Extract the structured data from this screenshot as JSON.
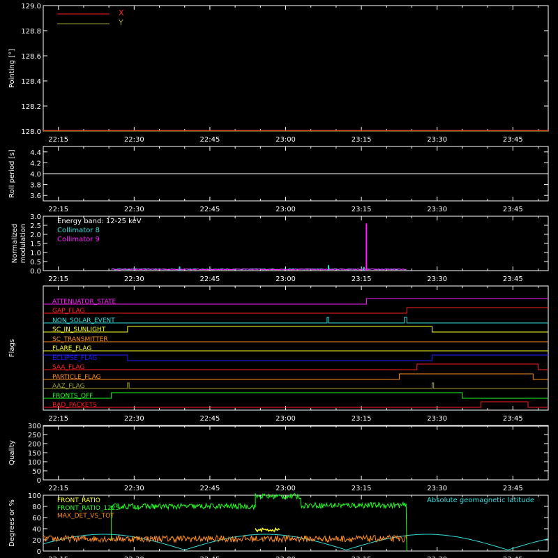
{
  "time_ticks": [
    "22:15",
    "22:30",
    "22:45",
    "23:00",
    "23:15",
    "23:30",
    "23:45"
  ],
  "time_tick_values": [
    0,
    15,
    30,
    45,
    60,
    75,
    90
  ],
  "time_range": [
    -3,
    97
  ],
  "colors": {
    "white": "#ffffff",
    "red": "#ff2020",
    "olive": "#a0a030",
    "cyan": "#30e0e0",
    "magenta": "#ff20ff",
    "green": "#20ff20",
    "orange": "#ff8c20",
    "yellow": "#ffff20",
    "blue": "#2020ff",
    "salmon": "#ff5050"
  },
  "chart_data": [
    {
      "type": "line",
      "ylabel": "Pointing [°]",
      "ylim": [
        128.0,
        129.0
      ],
      "yticks": [
        "128.0",
        "128.2",
        "128.4",
        "128.6",
        "128.8",
        "129.0"
      ],
      "ytick_values": [
        128.0,
        128.2,
        128.4,
        128.6,
        128.8,
        129.0
      ],
      "legend": [
        "X",
        "Y"
      ],
      "series": [
        {
          "name": "X",
          "x": [
            -3,
            97
          ],
          "y": [
            128.0,
            128.0
          ]
        },
        {
          "name": "Y",
          "x": [
            -3,
            97
          ],
          "y": [
            128.0,
            128.0
          ]
        }
      ]
    },
    {
      "type": "line",
      "ylabel": "Roll period [s]",
      "ylim": [
        3.5,
        4.5
      ],
      "yticks": [
        "3.6",
        "3.8",
        "4.0",
        "4.2",
        "4.4"
      ],
      "ytick_values": [
        3.6,
        3.8,
        4.0,
        4.2,
        4.4
      ],
      "series": [
        {
          "x": [
            -3,
            97
          ],
          "y": [
            4.0,
            4.0
          ]
        }
      ]
    },
    {
      "type": "line",
      "ylabel": "Normalized modulation",
      "ylim": [
        0.0,
        3.0
      ],
      "yticks": [
        "0.0",
        "0.5",
        "1.0",
        "1.5",
        "2.0",
        "2.5",
        "3.0"
      ],
      "ytick_values": [
        0.0,
        0.5,
        1.0,
        1.5,
        2.0,
        2.5,
        3.0
      ],
      "legend": [
        "Energy band: 12-25 keV",
        "Collimator 8",
        "Collimator 9"
      ],
      "series": [
        {
          "name": "Collimator 8",
          "range": [
            10.5,
            69
          ],
          "base": 0.05,
          "spikes": [
            [
              24,
              0.22
            ],
            [
              53.5,
              0.3
            ],
            [
              60.5,
              0.2
            ]
          ]
        },
        {
          "name": "Collimator 9",
          "range": [
            10.5,
            69
          ],
          "base": 0.04,
          "spikes": [
            [
              61,
              2.6
            ]
          ]
        }
      ]
    },
    {
      "type": "line",
      "ylabel": "Flags",
      "flags": [
        {
          "name": "ATTENUATOR_STATE",
          "steps": [
            [
              -3,
              0
            ],
            [
              61,
              1
            ],
            [
              97,
              1
            ]
          ]
        },
        {
          "name": "GAP_FLAG",
          "steps": [
            [
              -3,
              0
            ],
            [
              69,
              1
            ],
            [
              97,
              1
            ]
          ]
        },
        {
          "name": "NON_SOLAR_EVENT",
          "steps": [
            [
              -3,
              0
            ],
            [
              53.2,
              1
            ],
            [
              53.5,
              0
            ],
            [
              68.5,
              1
            ],
            [
              69,
              0
            ],
            [
              97,
              0
            ]
          ]
        },
        {
          "name": "SC_IN_SUNLIGHT",
          "steps": [
            [
              -3,
              0
            ],
            [
              13.7,
              1
            ],
            [
              74,
              0
            ],
            [
              97,
              0
            ]
          ]
        },
        {
          "name": "SC_TRANSMITTER",
          "steps": [
            [
              -3,
              0
            ],
            [
              97,
              0
            ]
          ]
        },
        {
          "name": "FLARE_FLAG",
          "steps": [
            [
              -3,
              0
            ],
            [
              97,
              0
            ]
          ]
        },
        {
          "name": "ECLIPSE_FLAG",
          "steps": [
            [
              -3,
              1
            ],
            [
              13.7,
              0
            ],
            [
              74,
              1
            ],
            [
              97,
              1
            ]
          ]
        },
        {
          "name": "SAA_FLAG",
          "steps": [
            [
              -3,
              0
            ],
            [
              71,
              1
            ],
            [
              95,
              0
            ],
            [
              97,
              0
            ]
          ]
        },
        {
          "name": "PARTICLE_FLAG",
          "steps": [
            [
              -3,
              0
            ],
            [
              67.5,
              1
            ],
            [
              94,
              0
            ],
            [
              97,
              0
            ]
          ]
        },
        {
          "name": "AAZ_FLAG",
          "steps": [
            [
              -3,
              0
            ],
            [
              13.7,
              1
            ],
            [
              14,
              0
            ],
            [
              74,
              1
            ],
            [
              74.3,
              0
            ],
            [
              97,
              0
            ]
          ]
        },
        {
          "name": "FRONTS_OFF",
          "steps": [
            [
              -3,
              0
            ],
            [
              10.5,
              1
            ],
            [
              80,
              0
            ],
            [
              97,
              0
            ]
          ]
        },
        {
          "name": "BAD_PACKETS",
          "steps": [
            [
              -3,
              0
            ],
            [
              83.7,
              1
            ],
            [
              93,
              0
            ],
            [
              97,
              0
            ]
          ]
        }
      ]
    },
    {
      "type": "line",
      "ylabel": "Quality",
      "ylim": [
        0,
        300
      ],
      "yticks": [
        "0",
        "50",
        "100",
        "150",
        "200",
        "250",
        "300"
      ],
      "ytick_values": [
        0,
        50,
        100,
        150,
        200,
        250,
        300
      ],
      "series": [
        {
          "x": [
            -3,
            97
          ],
          "y": [
            300,
            300
          ]
        }
      ]
    },
    {
      "type": "line",
      "ylabel": "Degrees or %",
      "ylim": [
        0,
        100
      ],
      "yticks": [
        "0",
        "20",
        "40",
        "60",
        "80",
        "100"
      ],
      "ytick_values": [
        0,
        20,
        40,
        60,
        80,
        100
      ],
      "legend": [
        "FRONT_RATIO",
        "FRONT_RATIO_1225",
        "MAX_DET_VS_TOT",
        "Absolute geomagnetic latitude"
      ],
      "series": [
        {
          "name": "FRONT_RATIO_1225",
          "range": [
            10.5,
            69
          ],
          "segments": [
            [
              10.5,
              39,
              80
            ],
            [
              39,
              48,
              98
            ],
            [
              48,
              69,
              82
            ]
          ]
        },
        {
          "name": "MAX_DET_VS_TOT",
          "range": [
            -3,
            69
          ],
          "base": 22
        },
        {
          "name": "FRONT_RATIO",
          "range": [
            39,
            44
          ],
          "base": 38
        },
        {
          "name": "Absolute geomagnetic latitude",
          "amplitude": [
            2,
            30
          ],
          "period": 32
        }
      ]
    }
  ]
}
